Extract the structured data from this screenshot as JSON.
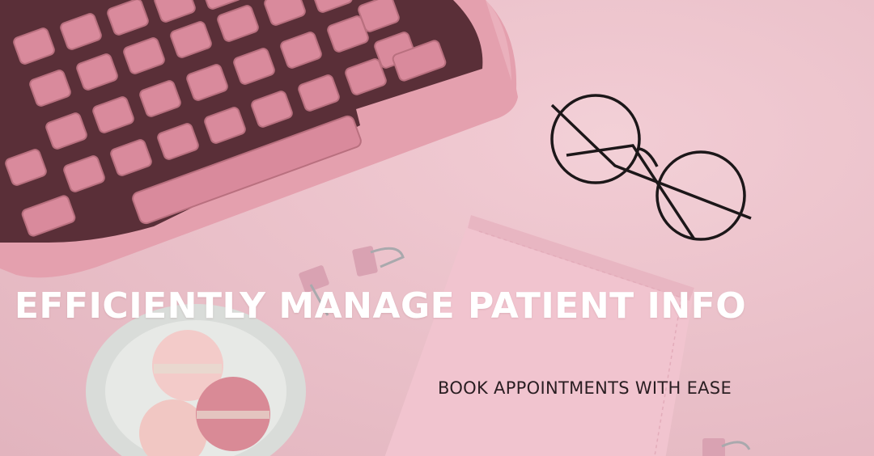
{
  "headline": "EFFICIENTLY MANAGE PATIENT INFO",
  "subheadline": "BOOK APPOINTMENTS WITH EASE",
  "photo": {
    "objects": [
      "pink-typewriter",
      "round-eyeglasses",
      "binder-clips",
      "pink-notebook",
      "macarons-plate"
    ]
  },
  "colors": {
    "background": "#ebc2cb",
    "headline_text": "#ffffff",
    "subheadline_text": "#2a1e22",
    "typewriter": "#e4a0ae",
    "notebook": "#f1c4cf"
  }
}
